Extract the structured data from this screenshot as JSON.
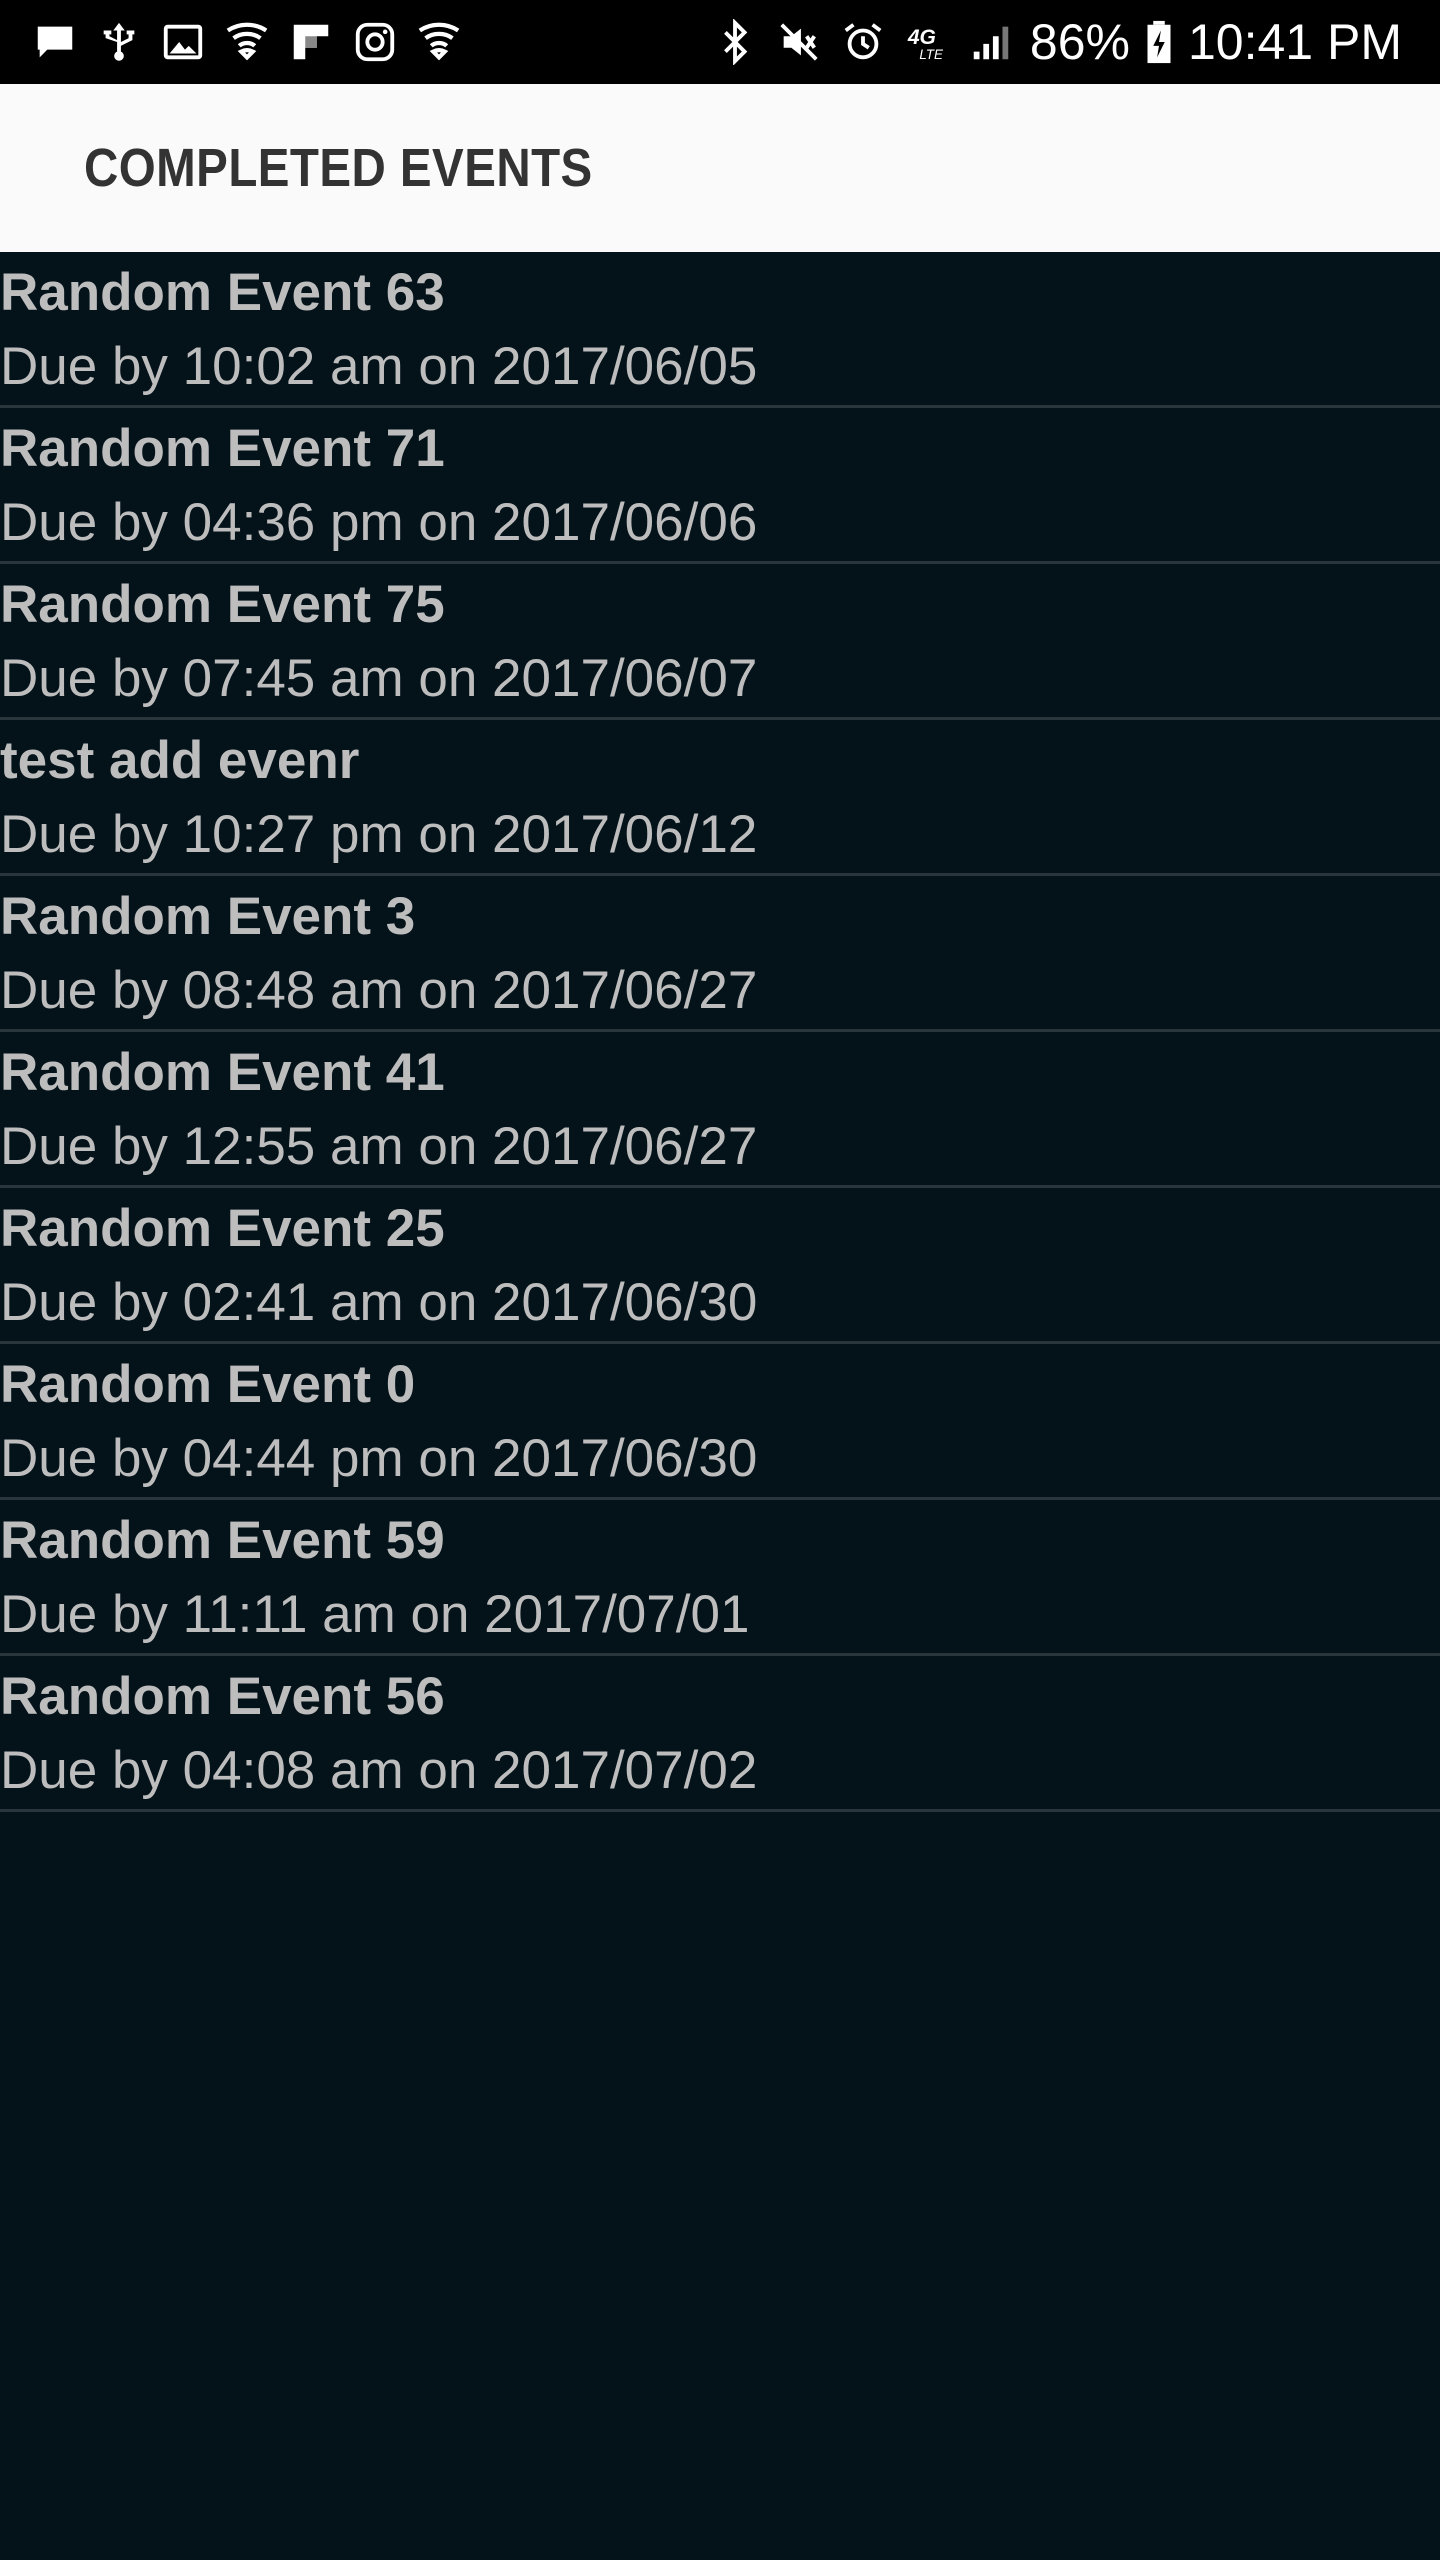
{
  "status_bar": {
    "left_icons": [
      "message-icon",
      "usb-debug-icon",
      "image-icon",
      "shield-wifi-icon",
      "flipboard-icon",
      "instagram-icon",
      "shield-wifi-icon"
    ],
    "right_icons": [
      "bluetooth-icon",
      "mute-icon",
      "alarm-icon",
      "4g-lte-icon",
      "signal-icon"
    ],
    "battery_percent": "86%",
    "time": "10:41 PM"
  },
  "app_bar": {
    "title": "COMPLETED EVENTS"
  },
  "events": [
    {
      "title": "Random Event 63",
      "due": "Due by 10:02 am on 2017/06/05"
    },
    {
      "title": "Random Event 71",
      "due": "Due by 04:36 pm on 2017/06/06"
    },
    {
      "title": "Random Event 75",
      "due": "Due by 07:45 am on 2017/06/07"
    },
    {
      "title": "test add evenr",
      "due": "Due by 10:27 pm on 2017/06/12"
    },
    {
      "title": "Random Event 3",
      "due": "Due by 08:48 am on 2017/06/27"
    },
    {
      "title": "Random Event 41",
      "due": "Due by 12:55 am on 2017/06/27"
    },
    {
      "title": "Random Event 25",
      "due": "Due by 02:41 am on 2017/06/30"
    },
    {
      "title": "Random Event 0",
      "due": "Due by 04:44 pm on 2017/06/30"
    },
    {
      "title": "Random Event 59",
      "due": "Due by 11:11 am on 2017/07/01"
    },
    {
      "title": "Random Event 56",
      "due": "Due by 04:08 am on 2017/07/02"
    }
  ],
  "colors": {
    "background": "#04121a",
    "app_bar": "#fafafa",
    "title_text": "#333333",
    "item_text": "#bdbdbd",
    "divider": "#2b363c"
  }
}
